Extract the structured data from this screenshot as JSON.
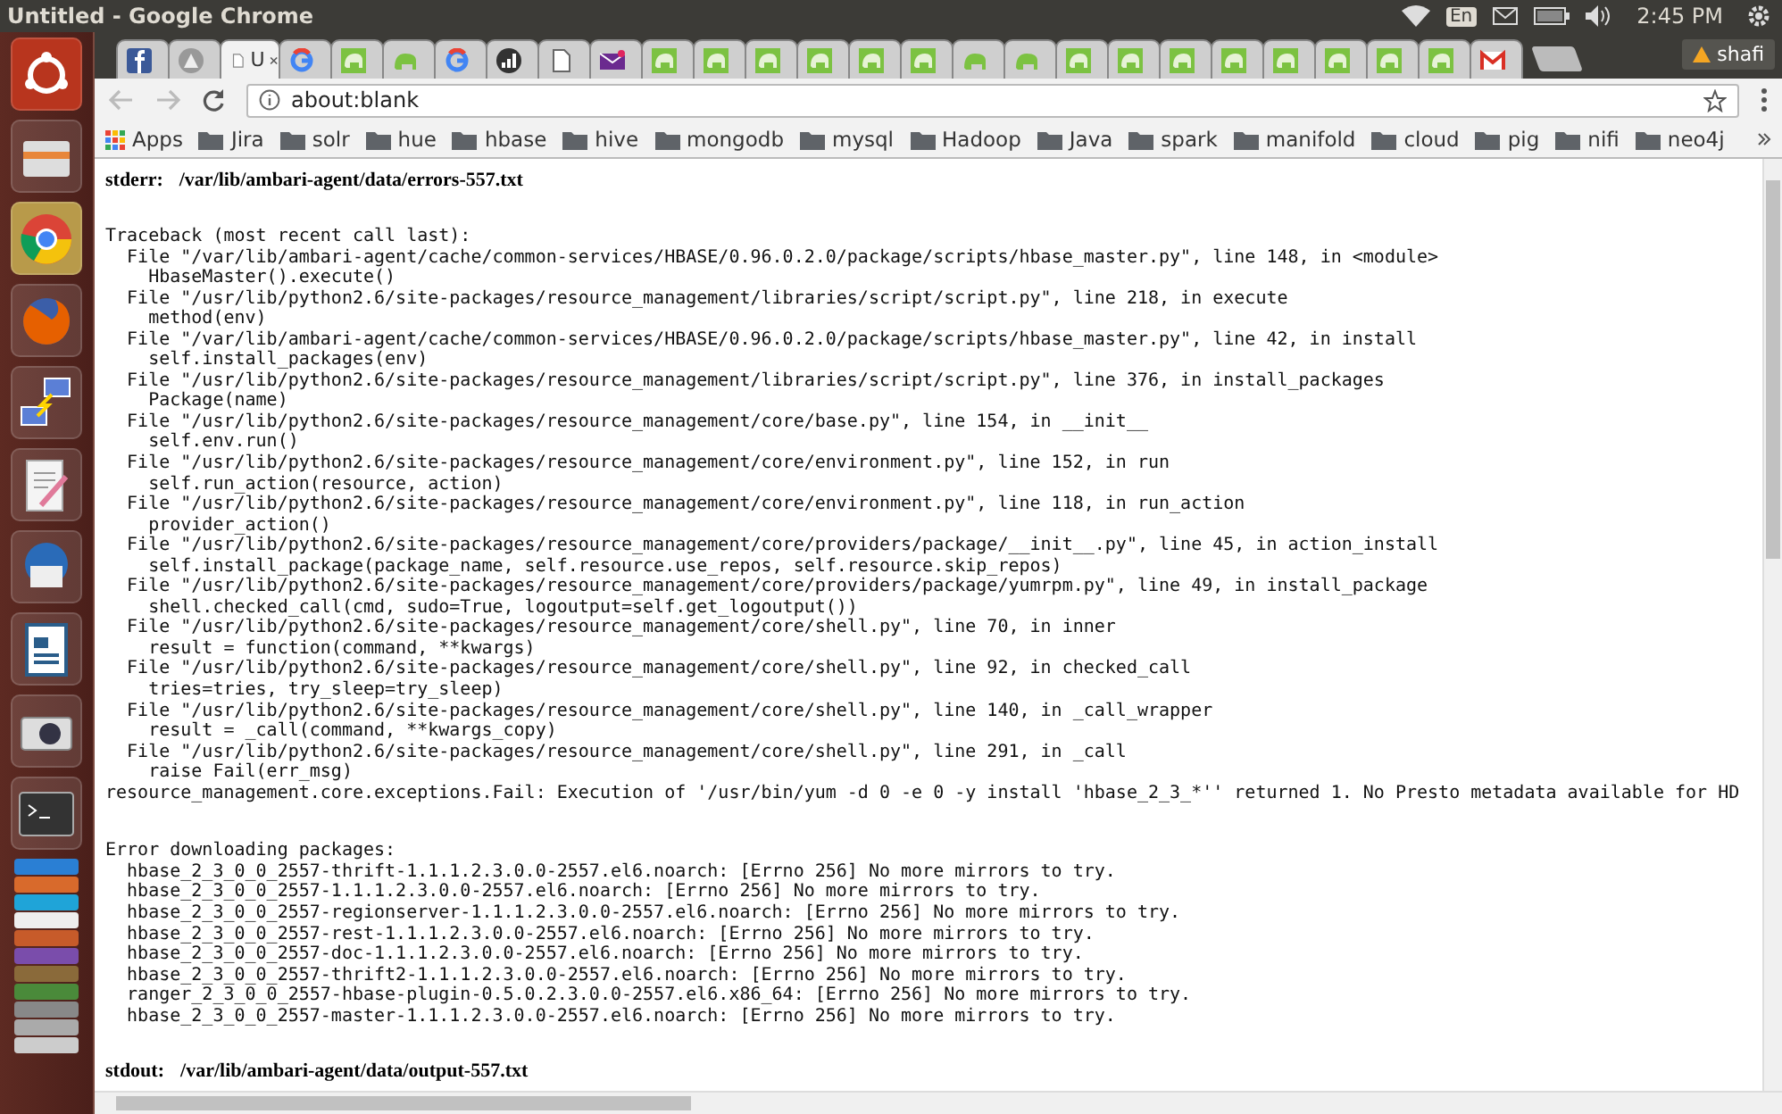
{
  "system_bar": {
    "title": "Untitled - Google Chrome",
    "keyboard": "En",
    "time": "2:45 PM"
  },
  "launcher": [
    {
      "kind": "ubuntu"
    },
    {
      "kind": "files"
    },
    {
      "kind": "chrome"
    },
    {
      "kind": "firefox"
    },
    {
      "kind": "network"
    },
    {
      "kind": "editor"
    },
    {
      "kind": "mail"
    },
    {
      "kind": "writer"
    },
    {
      "kind": "camera"
    },
    {
      "kind": "terminal"
    }
  ],
  "tabs": [
    {
      "kind": "facebook",
      "selected": false
    },
    {
      "kind": "avatar",
      "selected": false
    },
    {
      "kind": "page",
      "label": "U",
      "selected": true
    },
    {
      "kind": "google",
      "selected": false
    },
    {
      "kind": "hadoop",
      "selected": false
    },
    {
      "kind": "elephant",
      "selected": false
    },
    {
      "kind": "google",
      "selected": false
    },
    {
      "kind": "chart",
      "selected": false
    },
    {
      "kind": "doc",
      "selected": false
    },
    {
      "kind": "envelope",
      "selected": false
    },
    {
      "kind": "hadoop",
      "selected": false
    },
    {
      "kind": "hadoop",
      "selected": false
    },
    {
      "kind": "hadoop",
      "selected": false
    },
    {
      "kind": "hadoop",
      "selected": false
    },
    {
      "kind": "hadoop",
      "selected": false
    },
    {
      "kind": "hadoop",
      "selected": false
    },
    {
      "kind": "elephant",
      "selected": false
    },
    {
      "kind": "elephant",
      "selected": false
    },
    {
      "kind": "hadoop",
      "selected": false
    },
    {
      "kind": "hadoop",
      "selected": false
    },
    {
      "kind": "hadoop",
      "selected": false
    },
    {
      "kind": "hadoop",
      "selected": false
    },
    {
      "kind": "hadoop",
      "selected": false
    },
    {
      "kind": "hadoop",
      "selected": false
    },
    {
      "kind": "hadoop",
      "selected": false
    },
    {
      "kind": "hadoop",
      "selected": false
    },
    {
      "kind": "gmail",
      "selected": false
    }
  ],
  "profile": {
    "name": "shafi"
  },
  "address_bar": {
    "url": "about:blank"
  },
  "bookmarks": [
    {
      "kind": "apps",
      "label": "Apps"
    },
    {
      "kind": "folder",
      "label": "Jira"
    },
    {
      "kind": "folder",
      "label": "solr"
    },
    {
      "kind": "folder",
      "label": "hue"
    },
    {
      "kind": "folder",
      "label": "hbase"
    },
    {
      "kind": "folder",
      "label": "hive"
    },
    {
      "kind": "folder",
      "label": "mongodb"
    },
    {
      "kind": "folder",
      "label": "mysql"
    },
    {
      "kind": "folder",
      "label": "Hadoop"
    },
    {
      "kind": "folder",
      "label": "Java"
    },
    {
      "kind": "folder",
      "label": "spark"
    },
    {
      "kind": "folder",
      "label": "manifold"
    },
    {
      "kind": "folder",
      "label": "cloud"
    },
    {
      "kind": "folder",
      "label": "pig"
    },
    {
      "kind": "folder",
      "label": "nifi"
    },
    {
      "kind": "folder",
      "label": "neo4j"
    }
  ],
  "log": {
    "stderr_label": "stderr:",
    "stderr_path": "/var/lib/ambari-agent/data/errors-557.txt",
    "traceback": [
      "Traceback (most recent call last):",
      "  File \"/var/lib/ambari-agent/cache/common-services/HBASE/0.96.0.2.0/package/scripts/hbase_master.py\", line 148, in <module>",
      "    HbaseMaster().execute()",
      "  File \"/usr/lib/python2.6/site-packages/resource_management/libraries/script/script.py\", line 218, in execute",
      "    method(env)",
      "  File \"/var/lib/ambari-agent/cache/common-services/HBASE/0.96.0.2.0/package/scripts/hbase_master.py\", line 42, in install",
      "    self.install_packages(env)",
      "  File \"/usr/lib/python2.6/site-packages/resource_management/libraries/script/script.py\", line 376, in install_packages",
      "    Package(name)",
      "  File \"/usr/lib/python2.6/site-packages/resource_management/core/base.py\", line 154, in __init__",
      "    self.env.run()",
      "  File \"/usr/lib/python2.6/site-packages/resource_management/core/environment.py\", line 152, in run",
      "    self.run_action(resource, action)",
      "  File \"/usr/lib/python2.6/site-packages/resource_management/core/environment.py\", line 118, in run_action",
      "    provider_action()",
      "  File \"/usr/lib/python2.6/site-packages/resource_management/core/providers/package/__init__.py\", line 45, in action_install",
      "    self.install_package(package_name, self.resource.use_repos, self.resource.skip_repos)",
      "  File \"/usr/lib/python2.6/site-packages/resource_management/core/providers/package/yumrpm.py\", line 49, in install_package",
      "    shell.checked_call(cmd, sudo=True, logoutput=self.get_logoutput())",
      "  File \"/usr/lib/python2.6/site-packages/resource_management/core/shell.py\", line 70, in inner",
      "    result = function(command, **kwargs)",
      "  File \"/usr/lib/python2.6/site-packages/resource_management/core/shell.py\", line 92, in checked_call",
      "    tries=tries, try_sleep=try_sleep)",
      "  File \"/usr/lib/python2.6/site-packages/resource_management/core/shell.py\", line 140, in _call_wrapper",
      "    result = _call(command, **kwargs_copy)",
      "  File \"/usr/lib/python2.6/site-packages/resource_management/core/shell.py\", line 291, in _call",
      "    raise Fail(err_msg)",
      "resource_management.core.exceptions.Fail: Execution of '/usr/bin/yum -d 0 -e 0 -y install 'hbase_2_3_*'' returned 1. No Presto metadata available for HD"
    ],
    "errors": [
      "Error downloading packages:",
      "  hbase_2_3_0_0_2557-thrift-1.1.1.2.3.0.0-2557.el6.noarch: [Errno 256] No more mirrors to try.",
      "  hbase_2_3_0_0_2557-1.1.1.2.3.0.0-2557.el6.noarch: [Errno 256] No more mirrors to try.",
      "  hbase_2_3_0_0_2557-regionserver-1.1.1.2.3.0.0-2557.el6.noarch: [Errno 256] No more mirrors to try.",
      "  hbase_2_3_0_0_2557-rest-1.1.1.2.3.0.0-2557.el6.noarch: [Errno 256] No more mirrors to try.",
      "  hbase_2_3_0_0_2557-doc-1.1.1.2.3.0.0-2557.el6.noarch: [Errno 256] No more mirrors to try.",
      "  hbase_2_3_0_0_2557-thrift2-1.1.1.2.3.0.0-2557.el6.noarch: [Errno 256] No more mirrors to try.",
      "  ranger_2_3_0_0_2557-hbase-plugin-0.5.0.2.3.0.0-2557.el6.x86_64: [Errno 256] No more mirrors to try.",
      "  hbase_2_3_0_0_2557-master-1.1.1.2.3.0.0-2557.el6.noarch: [Errno 256] No more mirrors to try."
    ],
    "stdout_label": "stdout:",
    "stdout_path": "/var/lib/ambari-agent/data/output-557.txt"
  }
}
